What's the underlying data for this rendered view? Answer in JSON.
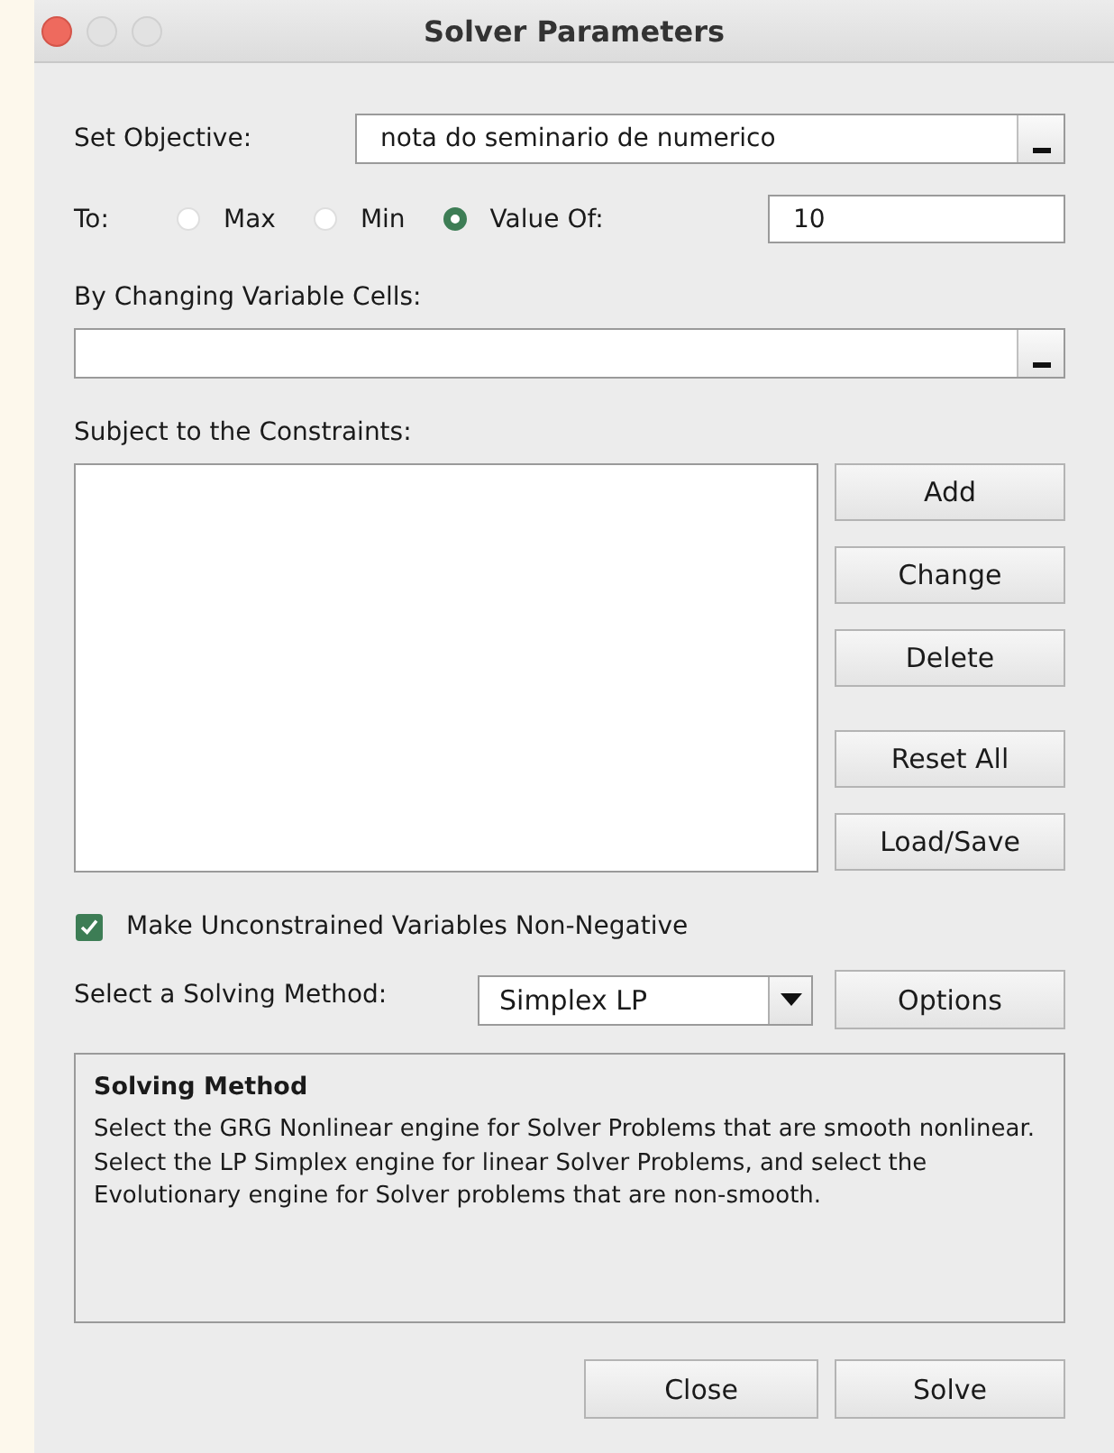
{
  "window": {
    "title": "Solver Parameters"
  },
  "objective": {
    "label": "Set Objective:",
    "value": "nota do seminario de numerico"
  },
  "to": {
    "label": "To:",
    "options": [
      {
        "label": "Max",
        "selected": false
      },
      {
        "label": "Min",
        "selected": false
      },
      {
        "label": "Value Of:",
        "selected": true
      }
    ],
    "value": "10"
  },
  "variable_cells": {
    "label": "By Changing Variable Cells:"
  },
  "constraints": {
    "label": "Subject to the Constraints:",
    "buttons": [
      "Add",
      "Change",
      "Delete",
      "Reset All",
      "Load/Save"
    ]
  },
  "non_negative": {
    "label": "Make Unconstrained Variables Non-Negative",
    "checked": true
  },
  "solving_method": {
    "label": "Select a Solving Method:",
    "value": "Simplex LP",
    "options_button": "Options"
  },
  "info": {
    "title": "Solving Method",
    "text": "Select the GRG Nonlinear engine for Solver Problems that are smooth nonlinear. Select the LP Simplex engine for linear Solver Problems, and select the Evolutionary engine for Solver problems that are non-smooth."
  },
  "buttons": [
    "Close",
    "Solve"
  ]
}
